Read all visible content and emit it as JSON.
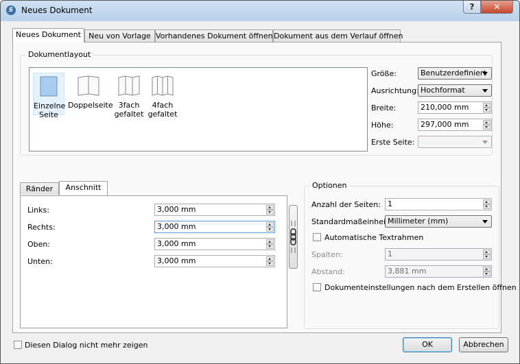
{
  "window": {
    "title": "Neues Dokument"
  },
  "tabs": [
    {
      "label": "Neues Dokument",
      "active": true
    },
    {
      "label": "Neu von Vorlage"
    },
    {
      "label": "Vorhandenes Dokument öffnen"
    },
    {
      "label": "Dokument aus dem Verlauf öffnen"
    }
  ],
  "layout": {
    "group_title": "Dokumentlayout",
    "items": [
      {
        "line1": "Einzelne",
        "line2": "Seite",
        "selected": true
      },
      {
        "line1": "Doppelseite",
        "line2": ""
      },
      {
        "line1": "3fach",
        "line2": "gefaltet"
      },
      {
        "line1": "4fach",
        "line2": "gefaltet"
      }
    ],
    "size_label": "Größe:",
    "size_value": "Benutzerdefiniert",
    "orientation_label": "Ausrichtung:",
    "orientation_value": "Hochformat",
    "width_label": "Breite:",
    "width_value": "210,000 mm",
    "height_label": "Höhe:",
    "height_value": "297,000 mm",
    "first_page_label": "Erste Seite:",
    "first_page_value": ""
  },
  "margins": {
    "tabs": [
      {
        "label": "Ränder"
      },
      {
        "label": "Anschnitt",
        "active": true
      }
    ],
    "left_label": "Links:",
    "left_value": "3,000 mm",
    "right_label": "Rechts:",
    "right_value": "3,000 mm",
    "top_label": "Oben:",
    "top_value": "3,000 mm",
    "bottom_label": "Unten:",
    "bottom_value": "3,000 mm"
  },
  "options": {
    "group_title": "Optionen",
    "pages_label": "Anzahl der Seiten:",
    "pages_value": "1",
    "unit_label": "Standardmaßeinheit:",
    "unit_value": "Millimeter (mm)",
    "auto_frames_label": "Automatische Textrahmen",
    "auto_frames_checked": false,
    "columns_label": "Spalten:",
    "columns_value": "1",
    "gap_label": "Abstand:",
    "gap_value": "3,881 mm",
    "open_settings_label": "Dokumenteinstellungen nach dem Erstellen öffnen",
    "open_settings_checked": false
  },
  "footer": {
    "dont_show_label": "Diesen Dialog nicht mehr zeigen",
    "ok_label": "OK",
    "cancel_label": "Abbrechen"
  },
  "colors": {
    "accent": "#3c7fb1",
    "titlebar": "#c4d8ee",
    "close": "#c7452c"
  }
}
